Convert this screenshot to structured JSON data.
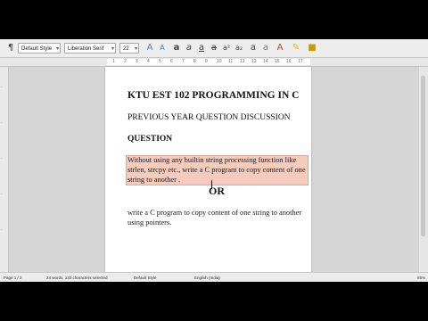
{
  "toolbar": {
    "paragraph_style": "Default Style",
    "font_name": "Liberation Serif",
    "font_size": "22",
    "icons": [
      "paragraph-style-icon",
      "update-style-icon",
      "new-style-icon",
      "bold-icon",
      "italic-icon",
      "underline-icon",
      "strikethrough-icon",
      "superscript-icon",
      "subscript-icon",
      "shadow-icon",
      "outline-icon",
      "font-color-icon",
      "highlight-icon",
      "background-color-icon"
    ]
  },
  "ruler": {
    "numbers": [
      "1",
      "2",
      "3",
      "4",
      "5",
      "6",
      "7",
      "8",
      "9",
      "10",
      "11",
      "12",
      "13",
      "14",
      "15",
      "16",
      "17"
    ]
  },
  "document": {
    "title": "KTU EST 102 PROGRAMMING IN C",
    "subtitle": "PREVIOUS YEAR QUESTION DISCUSSION",
    "question_heading": "QUESTION",
    "question_text": "Without using any builtin string processing function like strlen, strcpy etc., write a C program to copy content of one string to another .",
    "or_text": "OR",
    "alt_question": "write a C program to copy content of one string to another  using pointers."
  },
  "statusbar": {
    "page": "Page 1 / 2",
    "word_count": "24 words, 133 characters selected",
    "page_style": "Default Style",
    "language": "English (India)",
    "zoom": "85%"
  }
}
